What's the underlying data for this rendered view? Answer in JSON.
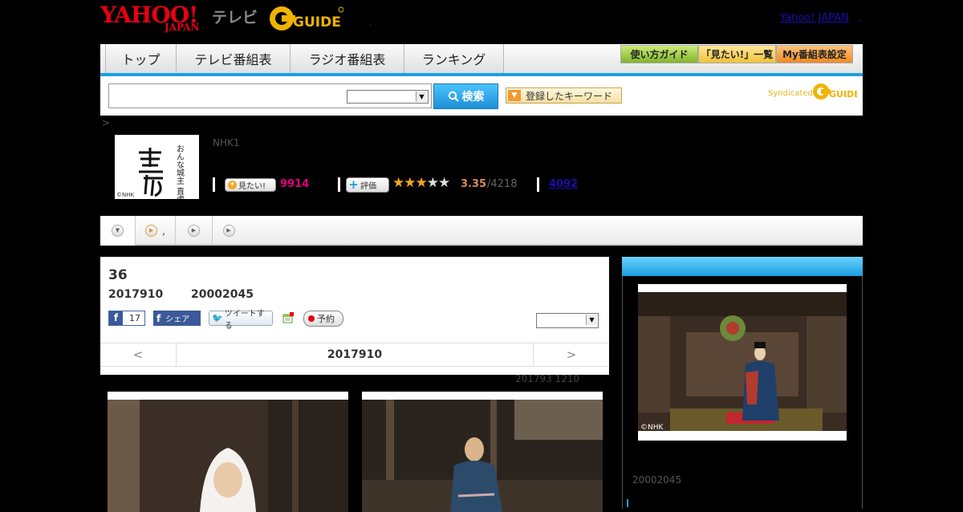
{
  "header": {
    "logo_yahoo": "YAHOO!",
    "logo_japan": "JAPAN",
    "logo_tv": "テレビ",
    "logo_gguide": "GUIDE",
    "yahoo_japan_link": "Yahoo! JAPAN",
    "dot": ","
  },
  "nav": {
    "tabs": [
      {
        "label": "トップ"
      },
      {
        "label": "テレビ番組表"
      },
      {
        "label": "ラジオ番組表"
      },
      {
        "label": "ランキング"
      }
    ],
    "buttons": [
      {
        "label": "使い方ガイド"
      },
      {
        "label": "「見たい!」一覧"
      },
      {
        "label": "My番組表設定"
      }
    ],
    "accent_color": "#1aa0e0"
  },
  "search": {
    "placeholder": "",
    "button_label": "検索",
    "keyword_button": "登録したキーワード",
    "syndicated": "Syndicated"
  },
  "breadcrumb": ">",
  "program": {
    "title_art": "おんな城主 直虎",
    "copyright": "©NHK",
    "channel": "NHK1",
    "mitai_label": "見たい!",
    "mitai_count": "9914",
    "hyoka_label": "評価",
    "stars_filled": 3,
    "stars_total": 5,
    "rating": "3.35",
    "rating_count": "/4218",
    "link_count": "4092"
  },
  "tabstrip": {
    "tabs": [
      {
        "icon": "down-arrow-icon",
        "label": ""
      },
      {
        "icon": "play-icon",
        "label": ","
      },
      {
        "icon": "play-icon",
        "label": ""
      },
      {
        "icon": "play-icon",
        "label": ""
      }
    ]
  },
  "episode": {
    "number": "36",
    "date": "2017910",
    "id": "20002045",
    "fb_like_count": "17",
    "fb_share_label": "シェア",
    "tweet_label": "ツイートする",
    "reserve_label": "予約",
    "pager_prev": "<",
    "pager_current": "2017910",
    "pager_next": ">",
    "air_note": "201793  1210"
  },
  "side": {
    "photo_copyright": "©NHK",
    "id": "20002045"
  }
}
